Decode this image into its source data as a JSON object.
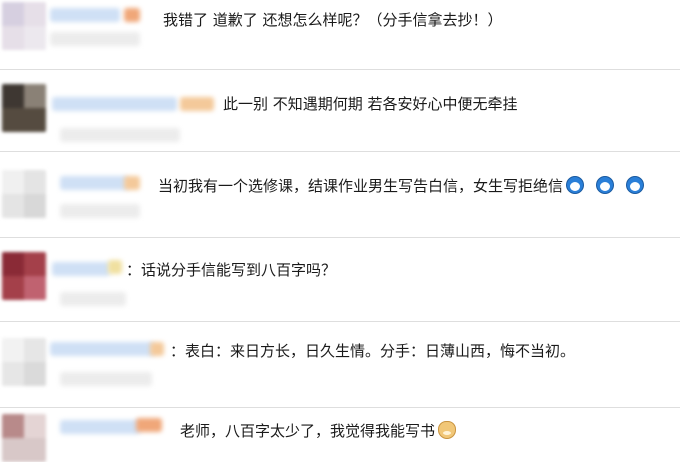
{
  "comments": [
    {
      "text": "我错了 道歉了 还想怎么样呢？（分手信拿去抄！）",
      "emojis": []
    },
    {
      "text": "此一别 不知遇期何期 若各安好心中便无牵挂",
      "emojis": []
    },
    {
      "text": "当初我有一个选修课，结课作业男生写告白信，女生写拒绝信",
      "emojis": [
        "doraemon",
        "doraemon",
        "doraemon"
      ]
    },
    {
      "text": "：话说分手信能写到八百字吗？",
      "emojis": []
    },
    {
      "text": "：表白：来日方长，日久生情。分手：日薄山西，悔不当初。",
      "emojis": []
    },
    {
      "text": "老师，八百字太少了，我觉得我能写书",
      "emojis": [
        "doge"
      ]
    }
  ],
  "colors": {
    "divider": "#dedede",
    "blur_blue": "#cfe0f5",
    "blur_gray": "#e8e8e8",
    "blur_orange": "#f4c99a"
  }
}
